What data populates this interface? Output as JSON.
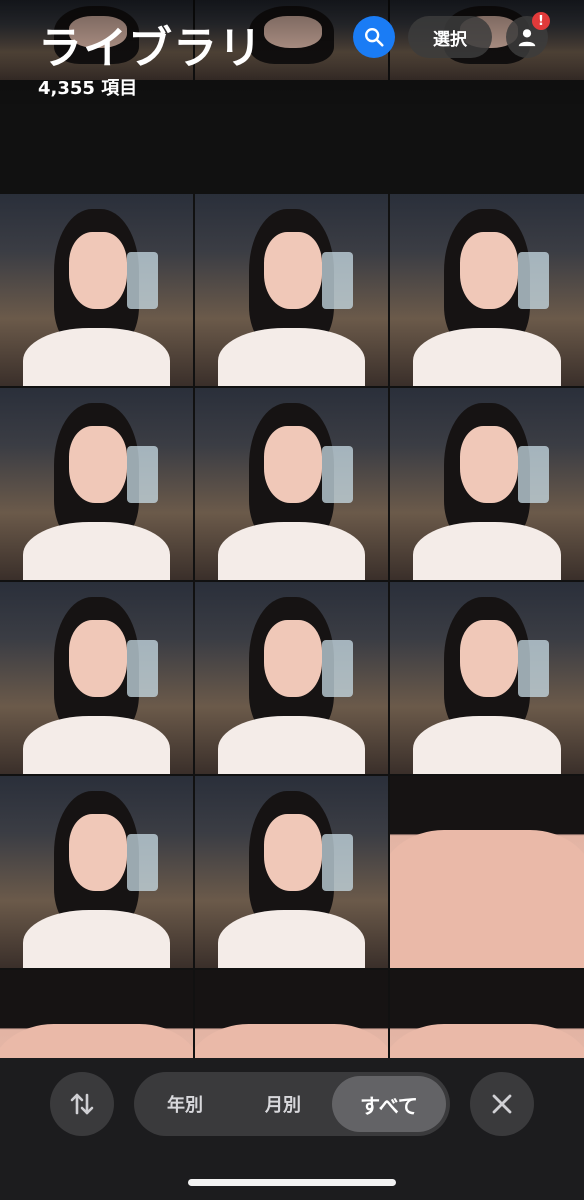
{
  "header": {
    "title": "ライブラリ",
    "item_count": "4,355 項目",
    "select_label": "選択",
    "alert_badge": "!"
  },
  "icons": {
    "search": "search-icon",
    "account": "person-icon",
    "sort": "sort-arrows-icon",
    "close": "close-icon"
  },
  "colors": {
    "search_button": "#1a7cf5",
    "alert_badge": "#e23a3a",
    "bar_background": "#1c1c1e"
  },
  "view_switcher": {
    "options": [
      "年別",
      "月別",
      "すべて"
    ],
    "selected": "すべて"
  },
  "grid": {
    "columns": 3,
    "full_rows": 5,
    "thumbnails": [
      {
        "kind": "top-strip"
      },
      {
        "kind": "top-strip"
      },
      {
        "kind": "top-strip"
      },
      {
        "kind": "selfie"
      },
      {
        "kind": "selfie"
      },
      {
        "kind": "selfie"
      },
      {
        "kind": "selfie"
      },
      {
        "kind": "selfie"
      },
      {
        "kind": "selfie"
      },
      {
        "kind": "selfie"
      },
      {
        "kind": "selfie"
      },
      {
        "kind": "selfie"
      },
      {
        "kind": "selfie"
      },
      {
        "kind": "selfie"
      },
      {
        "kind": "close-up"
      },
      {
        "kind": "close-up"
      },
      {
        "kind": "close-up"
      },
      {
        "kind": "close-up"
      }
    ]
  }
}
